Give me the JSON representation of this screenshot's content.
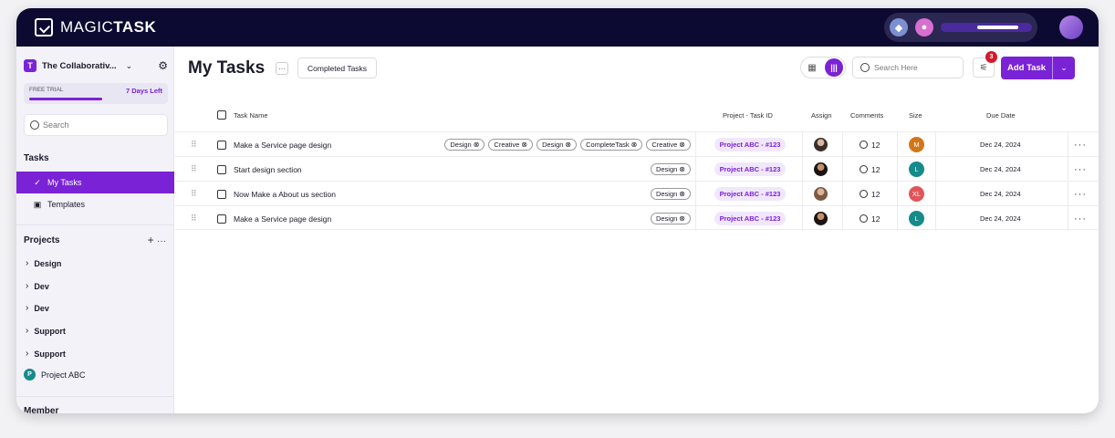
{
  "brand": {
    "logo_text": "MAGIC",
    "logo_bold": "TASK"
  },
  "colors": {
    "accent": "#7a22d6",
    "topbar": "#0c0a30",
    "badge_red": "#d41a2c"
  },
  "sidebar": {
    "workspace": {
      "badge": "T",
      "name": "The Collaborativ..."
    },
    "trial": {
      "label": "FREE TRIAL",
      "days_left": "7 Days Left",
      "progress": 0.5
    },
    "search_placeholder": "Search",
    "tasks_heading": "Tasks",
    "nav": [
      {
        "label": "My Tasks",
        "icon": "check-sparkle-icon",
        "active": true
      },
      {
        "label": "Templates",
        "icon": "template-icon",
        "active": false
      }
    ],
    "projects_heading": "Projects",
    "projects": [
      {
        "label": "Design"
      },
      {
        "label": "Dev"
      },
      {
        "label": "Dev"
      },
      {
        "label": "Support"
      },
      {
        "label": "Support"
      }
    ],
    "project_abc": {
      "avatar": "P",
      "label": "Project ABC"
    },
    "member_heading": "Member"
  },
  "main": {
    "title": "My Tasks",
    "completed_button": "Completed Tasks",
    "search_placeholder": "Search Here",
    "filter_count": "3",
    "add_button": "Add Task",
    "columns": {
      "task_name": "Task Name",
      "project": "Project - Task ID",
      "assign": "Assign",
      "comments": "Comments",
      "size": "Size",
      "due": "Due Date"
    },
    "rows": [
      {
        "name": "Make a Service page design",
        "tags": [
          "Design",
          "Creative",
          "Design",
          "CompleteTask",
          "Creative"
        ],
        "project": "Project ABC - #123",
        "comments": "12",
        "size": "M",
        "size_color": "#d3761a",
        "due": "Dec 24, 2024"
      },
      {
        "name": "Start design section",
        "tags": [
          "Design"
        ],
        "project": "Project ABC - #123",
        "comments": "12",
        "size": "L",
        "size_color": "#178a8a",
        "due": "Dec 24, 2024"
      },
      {
        "name": "Now Make a About us section",
        "tags": [
          "Design"
        ],
        "project": "Project ABC - #123",
        "comments": "12",
        "size": "XL",
        "size_color": "#e0555a",
        "due": "Dec 24, 2024"
      },
      {
        "name": "Make a Service page design",
        "tags": [
          "Design"
        ],
        "project": "Project ABC - #123",
        "comments": "12",
        "size": "L",
        "size_color": "#178a8a",
        "due": "Dec 24, 2024"
      }
    ]
  }
}
